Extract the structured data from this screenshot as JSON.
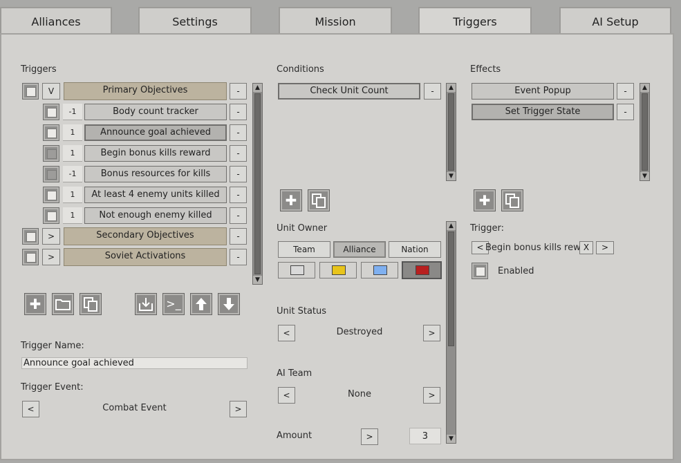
{
  "tabs": [
    "Alliances",
    "Settings",
    "Mission",
    "Triggers",
    "AI Setup"
  ],
  "triggers": {
    "heading": "Triggers",
    "groups": [
      {
        "toggle": "V",
        "label": "Primary Objectives",
        "remove": "-"
      },
      {
        "toggle": ">",
        "label": "Secondary Objectives",
        "remove": "-"
      },
      {
        "toggle": ">",
        "label": "Soviet Activations",
        "remove": "-"
      }
    ],
    "items": [
      {
        "num": "-1",
        "label": "Body count tracker",
        "remove": "-"
      },
      {
        "num": "1",
        "label": "Announce goal achieved",
        "remove": "-"
      },
      {
        "num": "1",
        "label": "Begin bonus kills reward",
        "remove": "-"
      },
      {
        "num": "-1",
        "label": "Bonus resources for kills",
        "remove": "-"
      },
      {
        "num": "1",
        "label": "At least 4 enemy units killed",
        "remove": "-"
      },
      {
        "num": "1",
        "label": "Not enough enemy killed",
        "remove": "-"
      }
    ],
    "toolbar_icons": [
      "add-icon",
      "folder-icon",
      "copy-icon",
      "import-icon",
      "console-icon",
      "move-up-icon",
      "move-down-icon"
    ],
    "name_label": "Trigger Name:",
    "name_value": "Announce goal achieved",
    "event_label": "Trigger Event:",
    "event_value": "Combat Event",
    "prev": "<",
    "next": ">"
  },
  "conditions": {
    "heading": "Conditions",
    "items": [
      {
        "label": "Check Unit Count",
        "remove": "-"
      }
    ],
    "unit_owner_label": "Unit Owner",
    "owner_options": [
      "Team",
      "Alliance",
      "Nation"
    ],
    "owner_selected": "Alliance",
    "colors": [
      "#d9d9d9",
      "#e8c41b",
      "#7fb0f0",
      "#b82020"
    ],
    "selected_color": "#b82020",
    "unit_status_label": "Unit Status",
    "unit_status_value": "Destroyed",
    "ai_team_label": "AI Team",
    "ai_team_value": "None",
    "amount_label": "Amount",
    "amount_value": "3",
    "prev": "<",
    "next": ">"
  },
  "effects": {
    "heading": "Effects",
    "items": [
      {
        "label": "Event Popup",
        "remove": "-"
      },
      {
        "label": "Set Trigger State",
        "remove": "-"
      }
    ],
    "trigger_label": "Trigger:",
    "trigger_value": "Begin bonus kills rewar",
    "clear": "X",
    "prev": "<",
    "next": ">",
    "enabled_label": "Enabled"
  }
}
